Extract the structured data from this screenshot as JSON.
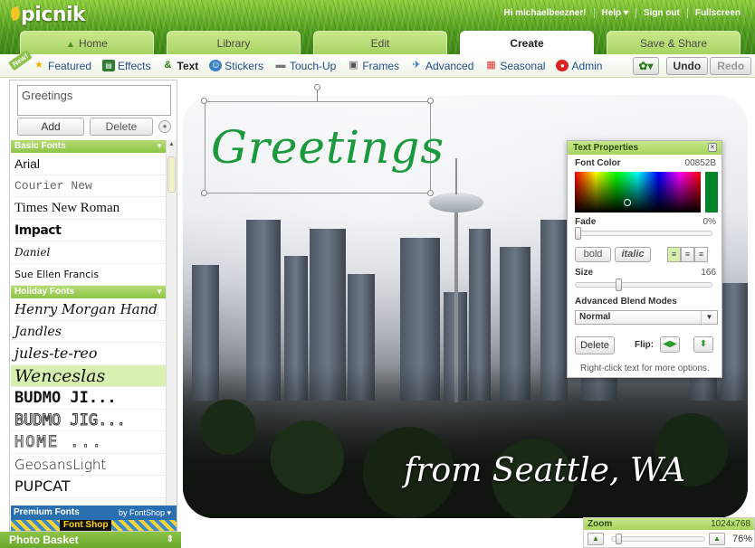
{
  "app": {
    "logo": "picnik"
  },
  "toplinks": {
    "greeting": "Hi michaelbeezner!",
    "help": "Help ▾",
    "signout": "Sign out",
    "fullscreen": "Fullscreen"
  },
  "tabs": [
    {
      "label": "Home"
    },
    {
      "label": "Library"
    },
    {
      "label": "Edit"
    },
    {
      "label": "Create"
    },
    {
      "label": "Save & Share"
    }
  ],
  "toolbar": {
    "new_badge": "New!",
    "items": [
      "Featured",
      "Effects",
      "Text",
      "Stickers",
      "Touch-Up",
      "Frames",
      "Advanced",
      "Seasonal",
      "Admin"
    ],
    "undo": "Undo",
    "redo": "Redo"
  },
  "left": {
    "text_value": "Greetings",
    "add": "Add",
    "delete": "Delete",
    "sections": {
      "basic": "Basic Fonts",
      "holiday": "Holiday Fonts",
      "premium": "Premium Fonts",
      "by": "by FontShop ▾",
      "fontshop": "Font Shop"
    },
    "basic_fonts": [
      "Arial",
      "Courier New",
      "Times New Roman",
      "Impact",
      "Daniel",
      "Sue Ellen Francis"
    ],
    "holiday_fonts": [
      "Henry Morgan Hand",
      "Jandles",
      "jules-te-reo",
      "Wenceslas",
      "BUDMO JI...",
      "BUDMO JIG...",
      "HOME ...",
      "GeosansLight",
      "PUPCAT"
    ],
    "selected_font": "Wenceslas",
    "photo_basket": "Photo Basket"
  },
  "canvas": {
    "greeting_text": "Greetings",
    "caption_text": "from Seattle, WA"
  },
  "props": {
    "title": "Text Properties",
    "font_color_label": "Font Color",
    "font_color_value": "00852B",
    "fade_label": "Fade",
    "fade_value": "0%",
    "bold": "bold",
    "italic": "italic",
    "size_label": "Size",
    "size_value": "166",
    "blend_label": "Advanced Blend Modes",
    "blend_value": "Normal",
    "delete": "Delete",
    "flip_label": "Flip:",
    "hint": "Right-click text for more options."
  },
  "zoom": {
    "title": "Zoom",
    "resolution": "1024x768",
    "percent": "76%"
  },
  "colors": {
    "accent_green": "#8dc447",
    "text_green": "#1a9a3c",
    "font_color": "#00852B"
  }
}
